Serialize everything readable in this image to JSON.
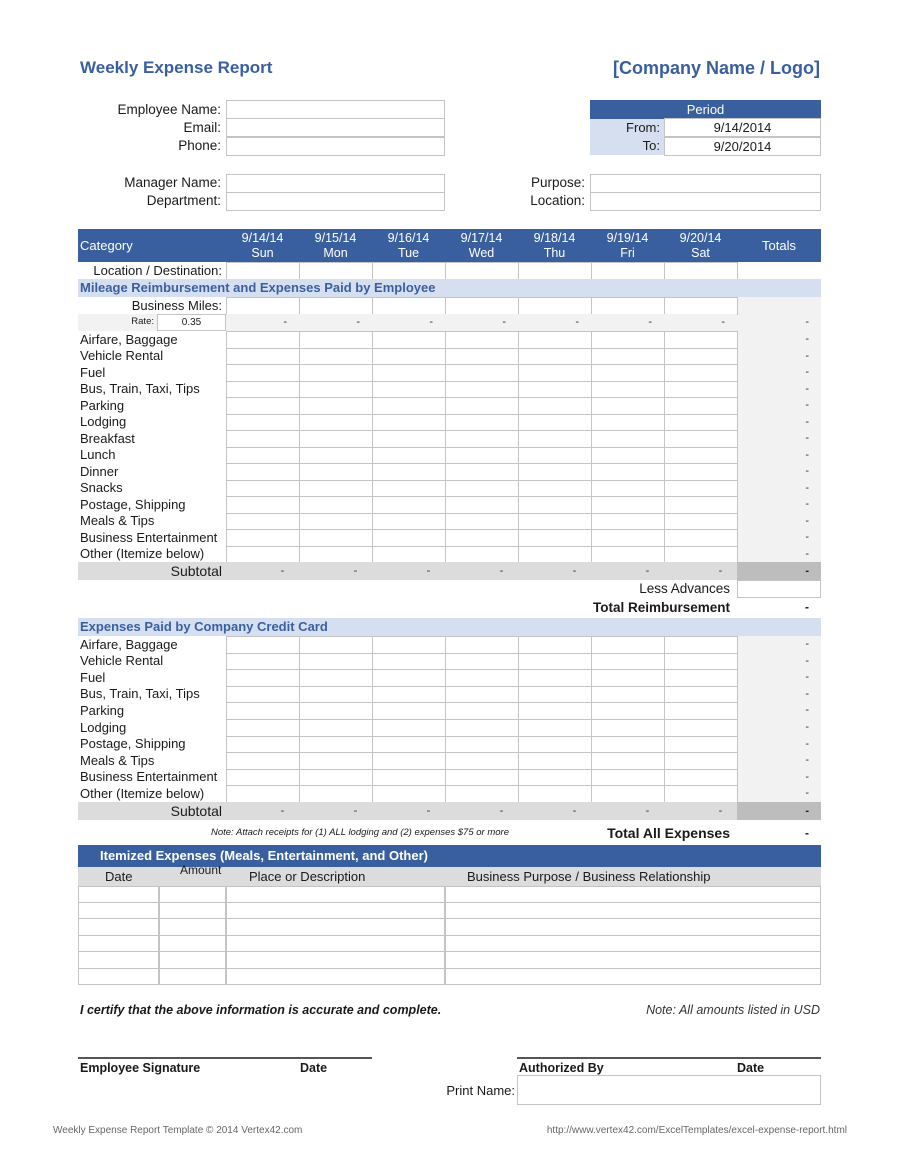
{
  "header": {
    "title": "Weekly Expense Report",
    "company": "[Company Name / Logo]"
  },
  "employee_info": {
    "employee_name_label": "Employee Name:",
    "email_label": "Email:",
    "phone_label": "Phone:",
    "manager_name_label": "Manager Name:",
    "department_label": "Department:",
    "employee_name": "",
    "email": "",
    "phone": "",
    "manager_name": "",
    "department": ""
  },
  "period": {
    "title": "Period",
    "from_label": "From:",
    "to_label": "To:",
    "from": "9/14/2014",
    "to": "9/20/2014"
  },
  "trip": {
    "purpose_label": "Purpose:",
    "location_label": "Location:",
    "purpose": "",
    "location": ""
  },
  "grid": {
    "category_label": "Category",
    "totals_label": "Totals",
    "days": [
      {
        "date": "9/14/14",
        "day": "Sun"
      },
      {
        "date": "9/15/14",
        "day": "Mon"
      },
      {
        "date": "9/16/14",
        "day": "Tue"
      },
      {
        "date": "9/17/14",
        "day": "Wed"
      },
      {
        "date": "9/18/14",
        "day": "Thu"
      },
      {
        "date": "9/19/14",
        "day": "Fri"
      },
      {
        "date": "9/20/14",
        "day": "Sat"
      }
    ],
    "location_label": "Location / Destination:",
    "empty_value": "-"
  },
  "mileage": {
    "section_title": "Mileage Reimbursement and Expenses Paid by Employee",
    "business_miles_label": "Business Miles:",
    "rate_label": "Rate:",
    "rate": "0.35",
    "categories": [
      "Airfare, Baggage",
      "Vehicle Rental",
      "Fuel",
      "Bus, Train, Taxi, Tips",
      "Parking",
      "Lodging",
      "Breakfast",
      "Lunch",
      "Dinner",
      "Snacks",
      "Postage, Shipping",
      "Meals & Tips",
      "Business Entertainment",
      "Other (Itemize below)"
    ],
    "subtotal_label": "Subtotal",
    "less_advances_label": "Less Advances",
    "less_advances": "",
    "total_reimbursement_label": "Total Reimbursement",
    "total_reimbursement": "-"
  },
  "credit_card": {
    "section_title": "Expenses Paid by Company Credit Card",
    "categories": [
      "Airfare, Baggage",
      "Vehicle Rental",
      "Fuel",
      "Bus, Train, Taxi, Tips",
      "Parking",
      "Lodging",
      "Postage, Shipping",
      "Meals & Tips",
      "Business Entertainment",
      "Other (Itemize below)"
    ],
    "subtotal_label": "Subtotal",
    "note": "Note: Attach receipts for (1) ALL lodging and (2) expenses $75 or more",
    "total_all_label": "Total All Expenses",
    "total_all": "-"
  },
  "itemized": {
    "title": "Itemized Expenses (Meals, Entertainment, and Other)",
    "columns": [
      "Date",
      "Amount",
      "Place or Description",
      "Business Purpose / Business Relationship"
    ],
    "row_count": 6
  },
  "certification": {
    "statement": "I certify that the above information is accurate and complete.",
    "currency_note": "Note: All amounts listed in USD",
    "employee_signature_label": "Employee Signature",
    "date_label": "Date",
    "authorized_by_label": "Authorized By",
    "date_label_2": "Date",
    "print_name_label": "Print Name:",
    "print_name": ""
  },
  "footer": {
    "left": "Weekly Expense Report Template © 2014 Vertex42.com",
    "right": "http://www.vertex42.com/ExcelTemplates/excel-expense-report.html"
  },
  "colors": {
    "accent": "#3a5f9f",
    "section_bg": "#d6dff0",
    "subtotal_bg": "#dcdcdc",
    "totals_bg": "#f2f2f2"
  }
}
